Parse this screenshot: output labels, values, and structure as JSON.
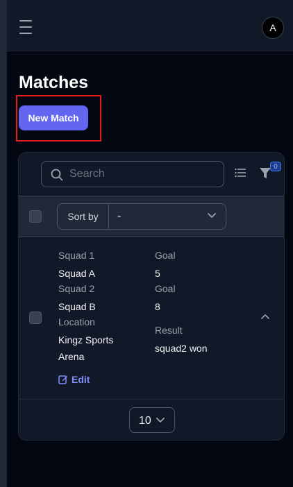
{
  "header": {
    "menu_icon": "hamburger-menu-icon",
    "avatar_initial": "A"
  },
  "page": {
    "title": "Matches",
    "new_button_label": "New Match"
  },
  "toolbar": {
    "search_placeholder": "Search",
    "filter_count": "0"
  },
  "sort": {
    "label": "Sort by",
    "value": "-"
  },
  "record": {
    "squad1_label": "Squad 1",
    "squad1_value": "Squad A",
    "goal1_label": "Goal",
    "goal1_value": "5",
    "squad2_label": "Squad 2",
    "squad2_value": "Squad B",
    "goal2_label": "Goal",
    "goal2_value": "8",
    "location_label": "Location",
    "location_value": "Kingz Sports Arena",
    "result_label": "Result",
    "result_value": "squad2 won",
    "edit_label": "Edit"
  },
  "pagination": {
    "per_page": "10"
  },
  "colors": {
    "primary": "#6366f1",
    "highlight": "#e11d1d",
    "background": "#030712"
  }
}
